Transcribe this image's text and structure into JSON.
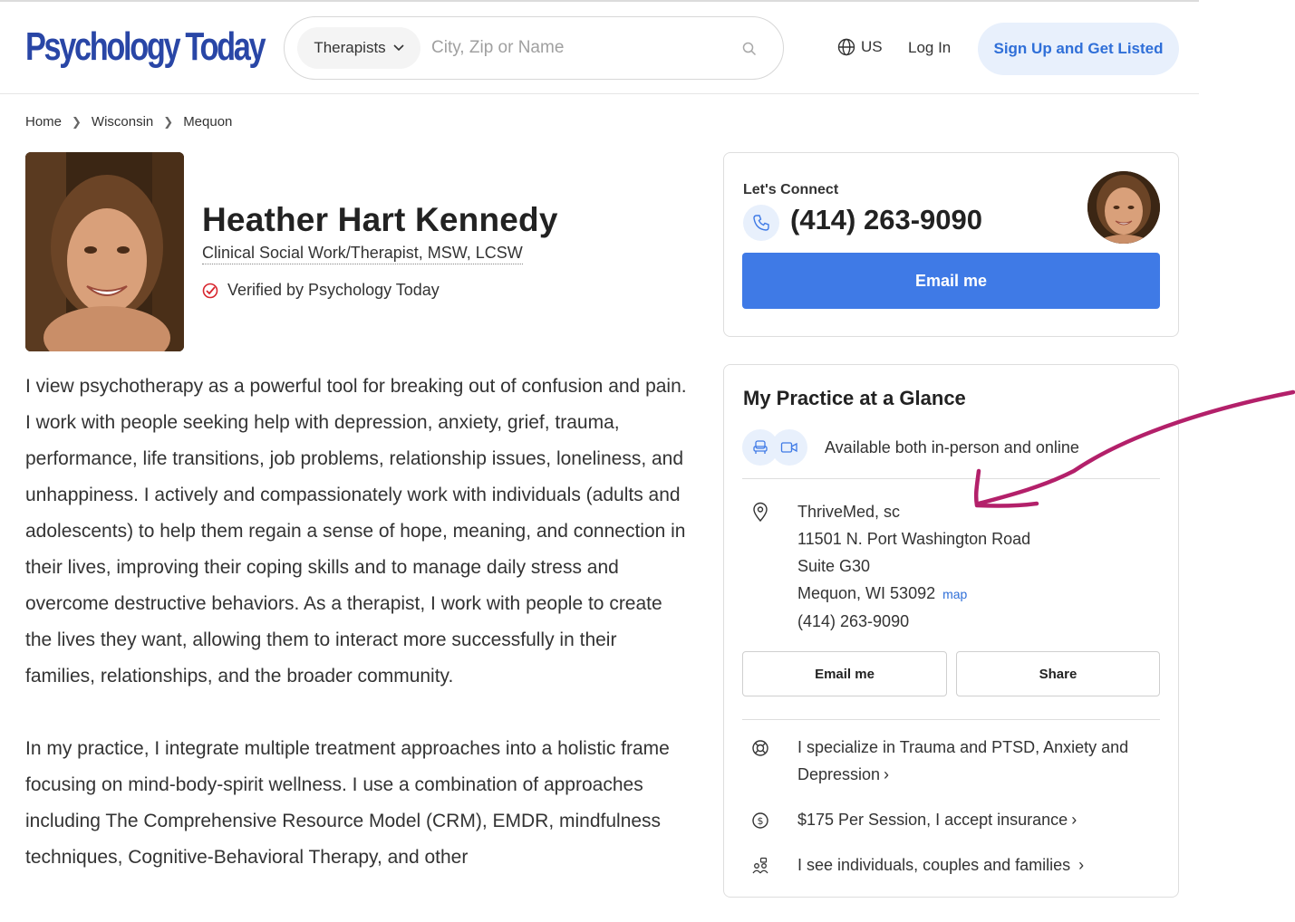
{
  "header": {
    "logo": "Psychology Today",
    "search_type": "Therapists",
    "search_placeholder": "City, Zip or Name",
    "country": "US",
    "login": "Log In",
    "signup": "Sign Up and Get Listed"
  },
  "breadcrumb": [
    "Home",
    "Wisconsin",
    "Mequon"
  ],
  "profile": {
    "name": "Heather Hart Kennedy",
    "credentials": "Clinical Social Work/Therapist, MSW, LCSW",
    "verified": "Verified by Psychology Today"
  },
  "bio": [
    "I view psychotherapy as a powerful tool for breaking out of confusion and pain. I work with people seeking help with depression, anxiety, grief, trauma, performance, life transitions, job problems, relationship issues, loneliness, and unhappiness. I actively and compassionately work with individuals (adults and adolescents) to help them regain a sense of hope, meaning, and connection in their lives, improving their coping skills and to manage daily stress and overcome destructive behaviors. As a therapist, I work with people to create the lives they want, allowing them to interact more successfully in their families, relationships, and the broader community.",
    "In my practice, I integrate multiple treatment approaches into a holistic frame focusing on mind-body-spirit wellness. I use a combination of approaches including The Comprehensive Resource Model (CRM), EMDR, mindfulness techniques, Cognitive-Behavioral Therapy, and other"
  ],
  "connect": {
    "label": "Let's Connect",
    "phone": "(414) 263-9090",
    "email_button": "Email me"
  },
  "glance": {
    "title": "My Practice at a Glance",
    "availability": "Available both in-person and online",
    "address": {
      "practice": "ThriveMed, sc",
      "street": "11501 N. Port Washington Road",
      "suite": "Suite G30",
      "city": "Mequon, WI 53092",
      "map_link": "map",
      "phone": "(414) 263-9090"
    },
    "email_button": "Email me",
    "share_button": "Share",
    "specialties_line1": "I specialize in Trauma and PTSD, Anxiety and",
    "specialties_line2": "Depression",
    "fee": "$175 Per Session, I accept insurance",
    "clients": "I see individuals, couples and families"
  },
  "colors": {
    "brand": "#2946a6",
    "primary_button": "#3f7ae6",
    "link": "#2f6fd8",
    "annotation_arrow": "#b3206a"
  }
}
